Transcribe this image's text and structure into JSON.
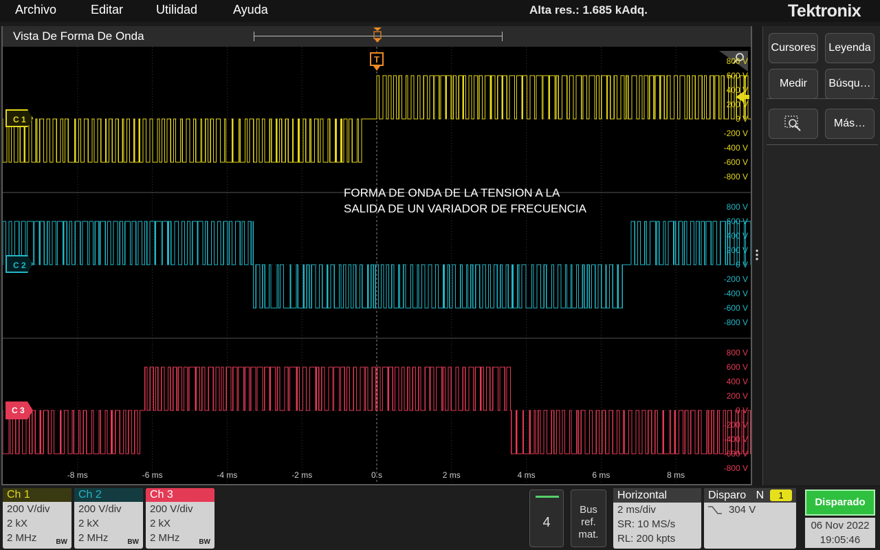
{
  "menu": {
    "items": [
      {
        "id": "archivo",
        "label": "Archivo"
      },
      {
        "id": "editar",
        "label": "Editar"
      },
      {
        "id": "utilidad",
        "label": "Utilidad"
      },
      {
        "id": "ayuda",
        "label": "Ayuda"
      }
    ],
    "acquisition_status": "Alta res.: 1.685 kAdq.",
    "brand": "Tektronix"
  },
  "waveform_view": {
    "title": "Vista De Forma De Onda",
    "trigger_marker": "T",
    "annotation": [
      "FORMA DE ONDA DE LA TENSION A LA",
      "SALIDA DE UN VARIADOR DE FRECUENCIA"
    ]
  },
  "colors": {
    "ch1": "#e6d71c",
    "ch2": "#21b8c8",
    "ch3": "#e33a55",
    "grid": "#3a3a3a",
    "trigger": "#f08a24",
    "triggered": "#30c040"
  },
  "chart_data": {
    "type": "line",
    "title": "",
    "xlabel": "",
    "x_ticks": [
      "-8 ms",
      "-6 ms",
      "-4 ms",
      "-2 ms",
      "0 s",
      "2 ms",
      "4 ms",
      "6 ms",
      "8 ms"
    ],
    "xlim_ms": [
      -10,
      10
    ],
    "series": [
      {
        "name": "C 1",
        "y_ticks": [
          "800 V",
          "600 V",
          "400 V",
          "200 V",
          "0 V",
          "-200 V",
          "-400 V",
          "-600 V",
          "-800 V"
        ],
        "ylim_V": [
          -800,
          800
        ],
        "pulse_amplitude_V": 600,
        "segments": [
          {
            "from_ms": -10,
            "to_ms": -0.3,
            "polarity": "negative"
          },
          {
            "from_ms": -0.3,
            "to_ms": 0,
            "polarity": "zero"
          },
          {
            "from_ms": 0,
            "to_ms": 10,
            "polarity": "positive"
          }
        ]
      },
      {
        "name": "C 2",
        "y_ticks": [
          "800 V",
          "600 V",
          "400 V",
          "200 V",
          "0 V",
          "-200 V",
          "-400 V",
          "-600 V",
          "-800 V"
        ],
        "ylim_V": [
          -800,
          800
        ],
        "pulse_amplitude_V": 600,
        "segments": [
          {
            "from_ms": -10,
            "to_ms": -3.3,
            "polarity": "positive"
          },
          {
            "from_ms": -3.3,
            "to_ms": 6.6,
            "polarity": "negative"
          },
          {
            "from_ms": 6.6,
            "to_ms": 6.8,
            "polarity": "zero"
          },
          {
            "from_ms": 6.8,
            "to_ms": 10,
            "polarity": "positive"
          }
        ]
      },
      {
        "name": "C 3",
        "y_ticks": [
          "800 V",
          "600 V",
          "400 V",
          "200 V",
          "0 V",
          "-200 V",
          "-400 V",
          "-600 V",
          "-800 V"
        ],
        "ylim_V": [
          -800,
          800
        ],
        "pulse_amplitude_V": 600,
        "segments": [
          {
            "from_ms": -10,
            "to_ms": -6.3,
            "polarity": "negative"
          },
          {
            "from_ms": -6.3,
            "to_ms": -6.2,
            "polarity": "zero"
          },
          {
            "from_ms": -6.2,
            "to_ms": 3.6,
            "polarity": "positive"
          },
          {
            "from_ms": 3.6,
            "to_ms": 10,
            "polarity": "negative"
          }
        ]
      }
    ]
  },
  "side_panel": {
    "cursores": "Cursores",
    "leyenda": "Leyenda",
    "medir": "Medir",
    "busqueda": "Búsqu…",
    "mas": "Más…"
  },
  "channels": [
    {
      "title": "Ch 1",
      "scale": "200 V/div",
      "impedance": "2 kX",
      "bandwidth": "2 MHz",
      "bw_icon": "BW"
    },
    {
      "title": "Ch 2",
      "scale": "200 V/div",
      "impedance": "2 kX",
      "bandwidth": "2 MHz",
      "bw_icon": "BW"
    },
    {
      "title": "Ch 3",
      "scale": "200 V/div",
      "impedance": "2 kX",
      "bandwidth": "2 MHz",
      "bw_icon": "BW"
    }
  ],
  "add_channel": {
    "number": "4"
  },
  "bus_ref": {
    "line1": "Bus",
    "line2": "ref.",
    "line3": "mat."
  },
  "horizontal": {
    "title": "Horizontal",
    "scale": "2 ms/div",
    "sample_rate": "SR: 10 MS/s",
    "record_length": "RL: 200 kpts"
  },
  "trigger": {
    "title": "Disparo",
    "mode": "N",
    "source": "1",
    "level": "304 V"
  },
  "status": {
    "state": "Disparado",
    "date": "06 Nov 2022",
    "time": "19:05:46"
  }
}
